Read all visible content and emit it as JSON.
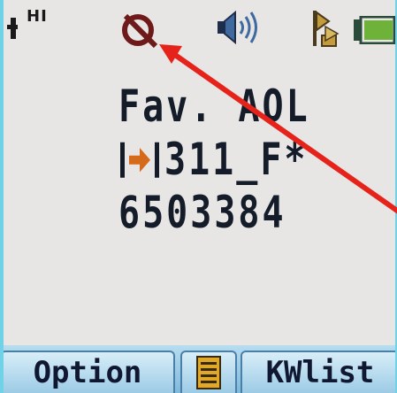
{
  "status_bar": {
    "signal_label": "HI",
    "icons": [
      "signal-icon",
      "do-not-disturb-icon",
      "speaker-icon",
      "flag-icon",
      "battery-icon"
    ]
  },
  "main": {
    "title": "Fav. AOL",
    "channel": "311_F*",
    "number": "6503384"
  },
  "softkeys": {
    "left_label": "Option",
    "center_icon": "menu-icon",
    "right_label": "KWlist"
  },
  "colors": {
    "background": "#e8e6e4",
    "text": "#141c2a",
    "accent": "#e5231b",
    "softkey": "#9ccbe6"
  }
}
